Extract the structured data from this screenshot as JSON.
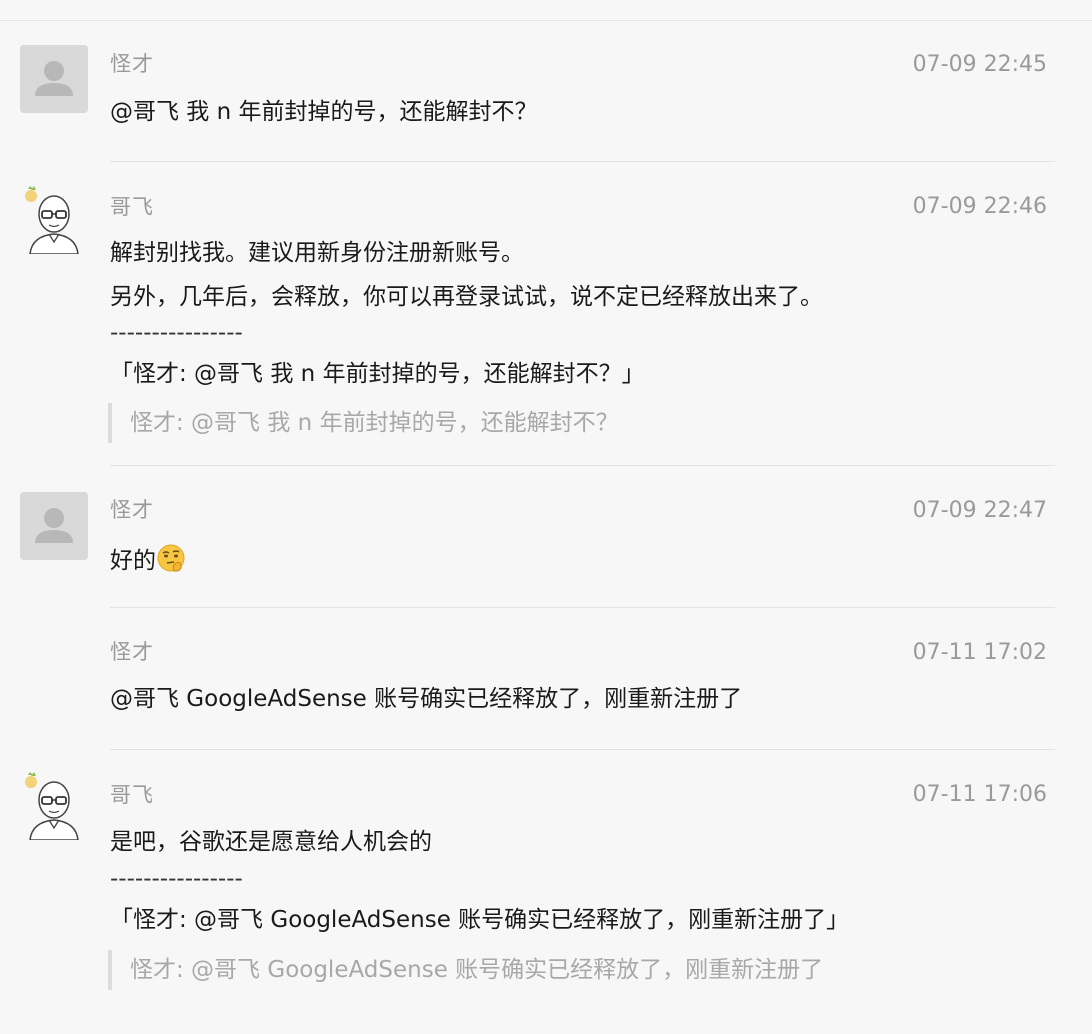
{
  "comments": [
    {
      "user": "怪才",
      "time": "07-09 22:45",
      "avatar": "default-avatar-icon",
      "lines": [
        "@哥飞 我 n 年前封掉的号，还能解封不？"
      ]
    },
    {
      "user": "哥飞",
      "time": "07-09 22:46",
      "avatar": "bald-glasses-avatar-icon",
      "lines": [
        "解封别找我。建议用新身份注册新账号。",
        "另外，几年后，会释放，你可以再登录试试，说不定已经释放出来了。",
        "----------------",
        "「怪才: @哥飞 我 n 年前封掉的号，还能解封不？」"
      ],
      "quote": "怪才: @哥飞 我 n 年前封掉的号，还能解封不？"
    },
    {
      "user": "怪才",
      "time": "07-09 22:47",
      "avatar": "default-avatar-icon",
      "lines": [
        "好的"
      ],
      "emoji": "thinking-face-emoji"
    },
    {
      "user": "怪才",
      "time": "07-11 17:02",
      "lines": [
        "@哥飞 GoogleAdSense 账号确实已经释放了，刚重新注册了"
      ]
    },
    {
      "user": "哥飞",
      "time": "07-11 17:06",
      "avatar": "bald-glasses-avatar-icon",
      "lines": [
        "是吧，谷歌还是愿意给人机会的",
        "----------------",
        "「怪才: @哥飞 GoogleAdSense 账号确实已经释放了，刚重新注册了」"
      ],
      "quote": "怪才: @哥飞 GoogleAdSense 账号确实已经释放了，刚重新注册了"
    }
  ]
}
